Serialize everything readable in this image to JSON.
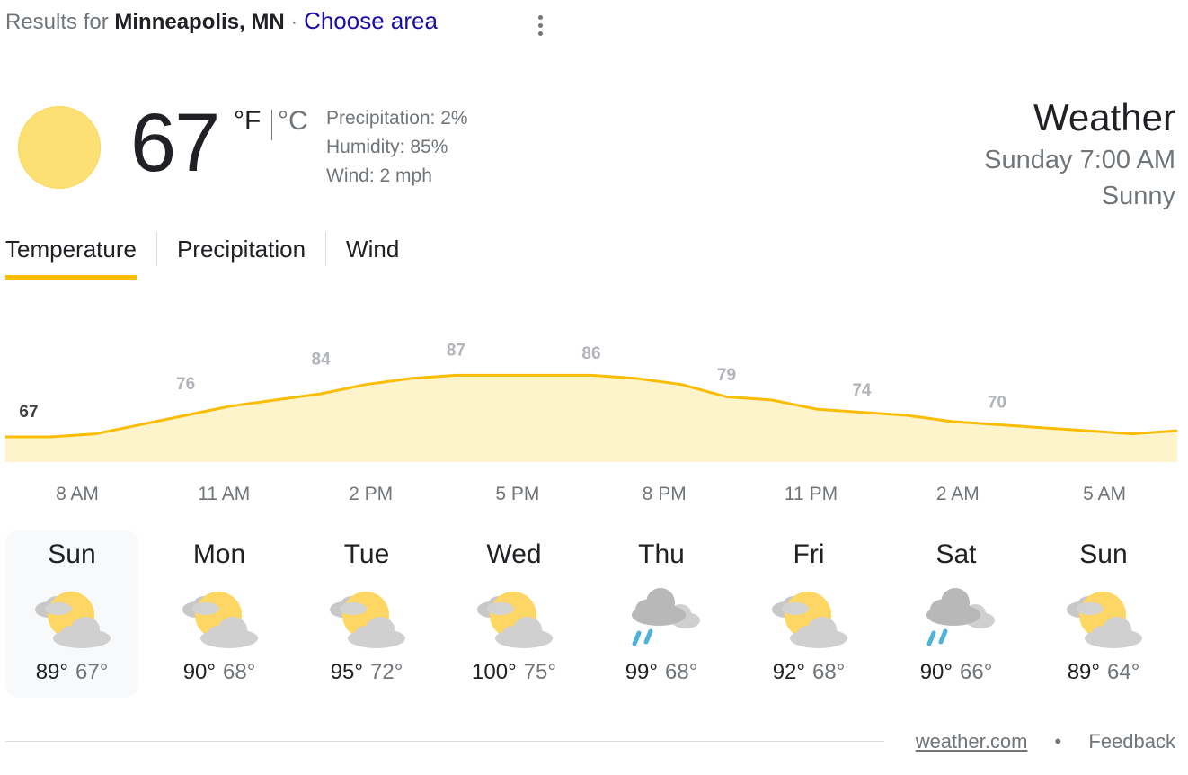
{
  "header": {
    "prefix": "Results for",
    "location": "Minneapolis, MN",
    "separator": "·",
    "choose_area": "Choose area"
  },
  "current": {
    "temperature": "67",
    "unit_f": "°F",
    "unit_c": "°C",
    "precipitation": "Precipitation: 2%",
    "humidity": "Humidity: 85%",
    "wind": "Wind: 2 mph",
    "icon": "sunny-icon",
    "title": "Weather",
    "datetime": "Sunday 7:00 AM",
    "condition": "Sunny"
  },
  "tabs": [
    {
      "label": "Temperature",
      "active": true
    },
    {
      "label": "Precipitation",
      "active": false
    },
    {
      "label": "Wind",
      "active": false
    }
  ],
  "chart_data": {
    "type": "area",
    "series_color": "#fbbc04",
    "fill_color": "#fef4cc",
    "labels": [
      "67",
      "76",
      "84",
      "87",
      "86",
      "79",
      "74",
      "70"
    ],
    "hour_labels": [
      "8 AM",
      "11 AM",
      "2 PM",
      "5 PM",
      "8 PM",
      "11 PM",
      "2 AM",
      "5 AM"
    ],
    "hourly_values": [
      67,
      67,
      68,
      71,
      74,
      77,
      79,
      81,
      84,
      86,
      87,
      87,
      87,
      87,
      86,
      84,
      80,
      79,
      76,
      75,
      74,
      72,
      71,
      70,
      69,
      68,
      69
    ]
  },
  "days": [
    {
      "name": "Sun",
      "high": "89°",
      "low": "67°",
      "icon": "partly-cloudy-icon",
      "selected": true
    },
    {
      "name": "Mon",
      "high": "90°",
      "low": "68°",
      "icon": "partly-cloudy-icon",
      "selected": false
    },
    {
      "name": "Tue",
      "high": "95°",
      "low": "72°",
      "icon": "partly-cloudy-icon",
      "selected": false
    },
    {
      "name": "Wed",
      "high": "100°",
      "low": "75°",
      "icon": "partly-cloudy-icon",
      "selected": false
    },
    {
      "name": "Thu",
      "high": "99°",
      "low": "68°",
      "icon": "rain-icon",
      "selected": false
    },
    {
      "name": "Fri",
      "high": "92°",
      "low": "68°",
      "icon": "partly-cloudy-icon",
      "selected": false
    },
    {
      "name": "Sat",
      "high": "90°",
      "low": "66°",
      "icon": "rain-icon",
      "selected": false
    },
    {
      "name": "Sun",
      "high": "89°",
      "low": "64°",
      "icon": "partly-cloudy-icon",
      "selected": false
    }
  ],
  "footer": {
    "source": "weather.com",
    "separator": "•",
    "feedback": "Feedback"
  }
}
